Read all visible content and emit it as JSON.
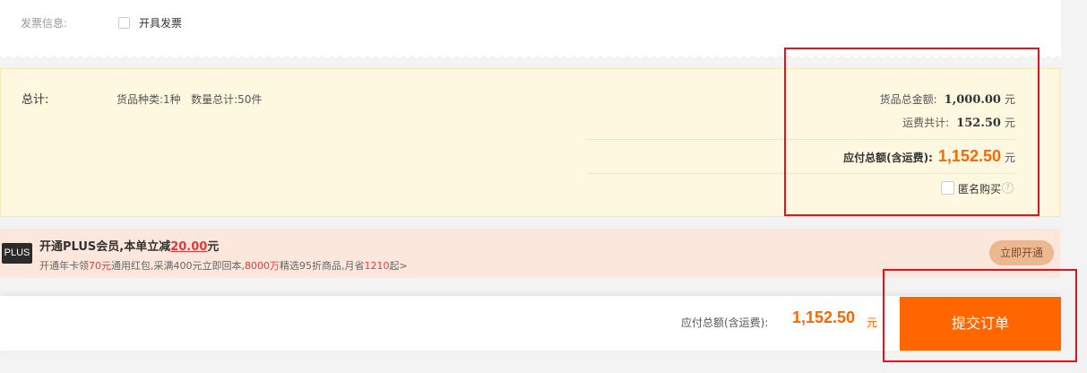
{
  "invoice": {
    "label": "发票信息:",
    "option": "开具发票"
  },
  "summary": {
    "label": "总计:",
    "kinds": "货品种类:1种",
    "quantity": "数量总计:50件",
    "goods_total_label": "货品总金额:",
    "goods_total": "1,000.00",
    "shipping_label": "运费共计:",
    "shipping": "152.50",
    "payable_label": "应付总额(含运费):",
    "payable": "1,152.50",
    "currency": "元",
    "anonymous_label": "匿名购买",
    "help_icon": "?"
  },
  "plus": {
    "logo": "PLUS",
    "title_prefix": "开通PLUS会员,本单立减",
    "title_amount": "20.00",
    "title_suffix": "元",
    "desc_1": "开通年卡领",
    "desc_hl_1": "70元",
    "desc_2": "通用红包,采满400元立即回本,",
    "desc_hl_2": "8000万",
    "desc_3": "精选95折商品,月省",
    "desc_hl_3": "1210",
    "desc_4": "起>",
    "button": "立即开通"
  },
  "bottom": {
    "payable_label": "应付总额(含运费):",
    "payable": "1,152.50",
    "currency": "元",
    "submit": "提交订单"
  },
  "colors": {
    "accent": "#ff6600",
    "highlight_box": "#e4121a",
    "summary_bg": "#fff8e0",
    "plus_bg": "#fbe7dc"
  }
}
